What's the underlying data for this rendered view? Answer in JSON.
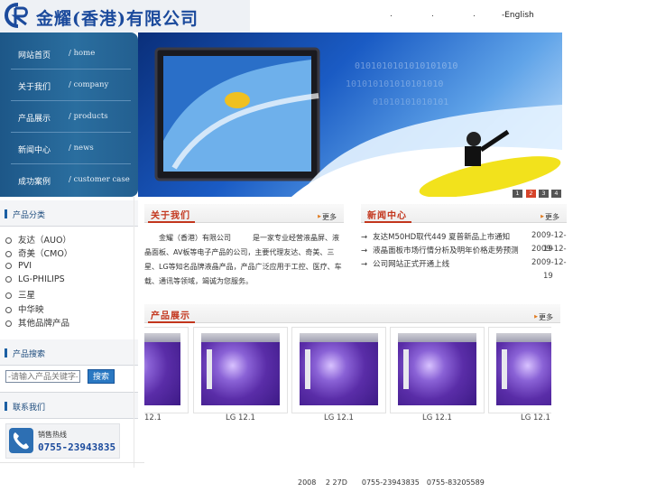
{
  "header": {
    "company_name": "金耀(香港)有限公司",
    "top_links": [
      ".",
      ".",
      "."
    ],
    "english_link": "-English"
  },
  "nav": {
    "items": [
      {
        "cn": "网站首页",
        "en": "/ home"
      },
      {
        "cn": "关于我们",
        "en": "/ company"
      },
      {
        "cn": "产品展示",
        "en": "/ products"
      },
      {
        "cn": "新闻中心",
        "en": "/ news"
      },
      {
        "cn": "成功案例",
        "en": "/ customer case"
      }
    ]
  },
  "banner": {
    "pager": [
      "1",
      "2",
      "3",
      "4"
    ],
    "active_page": "2"
  },
  "sidebar": {
    "category_title": "产品分类",
    "brands": [
      "友达（AUO）",
      "奇美（CMO）",
      "PVI",
      "LG-PHILIPS",
      "三星",
      "中华映",
      "其他品牌产品"
    ],
    "search_title": "产品搜索",
    "search_placeholder": "-请输入产品关键字-",
    "search_button": "搜索",
    "contact_title": "联系我们",
    "hotline_label": "销售热线",
    "hotline_number": "0755-23943835"
  },
  "about": {
    "title": "关于我们",
    "more": "更多",
    "text": "　　金耀（香港）有限公司　　　是一家专业经营液晶屏、液晶面板、AV板等电子产品的公司，主要代理友达、奇美、三星、LG等知名品牌液晶产品，产品广泛应用于工控、医疗、车载、通讯等领域，竭诚为您服务。"
  },
  "news": {
    "title": "新闻中心",
    "more": "更多",
    "items": [
      {
        "title": "友达M50HD取代449 夏普新品上市通知",
        "date": "2009-12-"
      },
      {
        "title": "液晶面板市场行情分析及明年价格走势预测",
        "date": "2009-12-"
      },
      {
        "title": "公司网站正式开通上线",
        "date": "2009-12-"
      }
    ],
    "date_tails": [
      "19",
      "19"
    ]
  },
  "products": {
    "title": "产品展示",
    "more": "更多",
    "labels": [
      "12.1",
      "LG 12.1",
      "LG 12.1",
      "LG 12.1",
      "LG 12.1"
    ]
  },
  "footer": {
    "text": "2008　 2 27D　　0755-23943835　0755-83205589"
  }
}
